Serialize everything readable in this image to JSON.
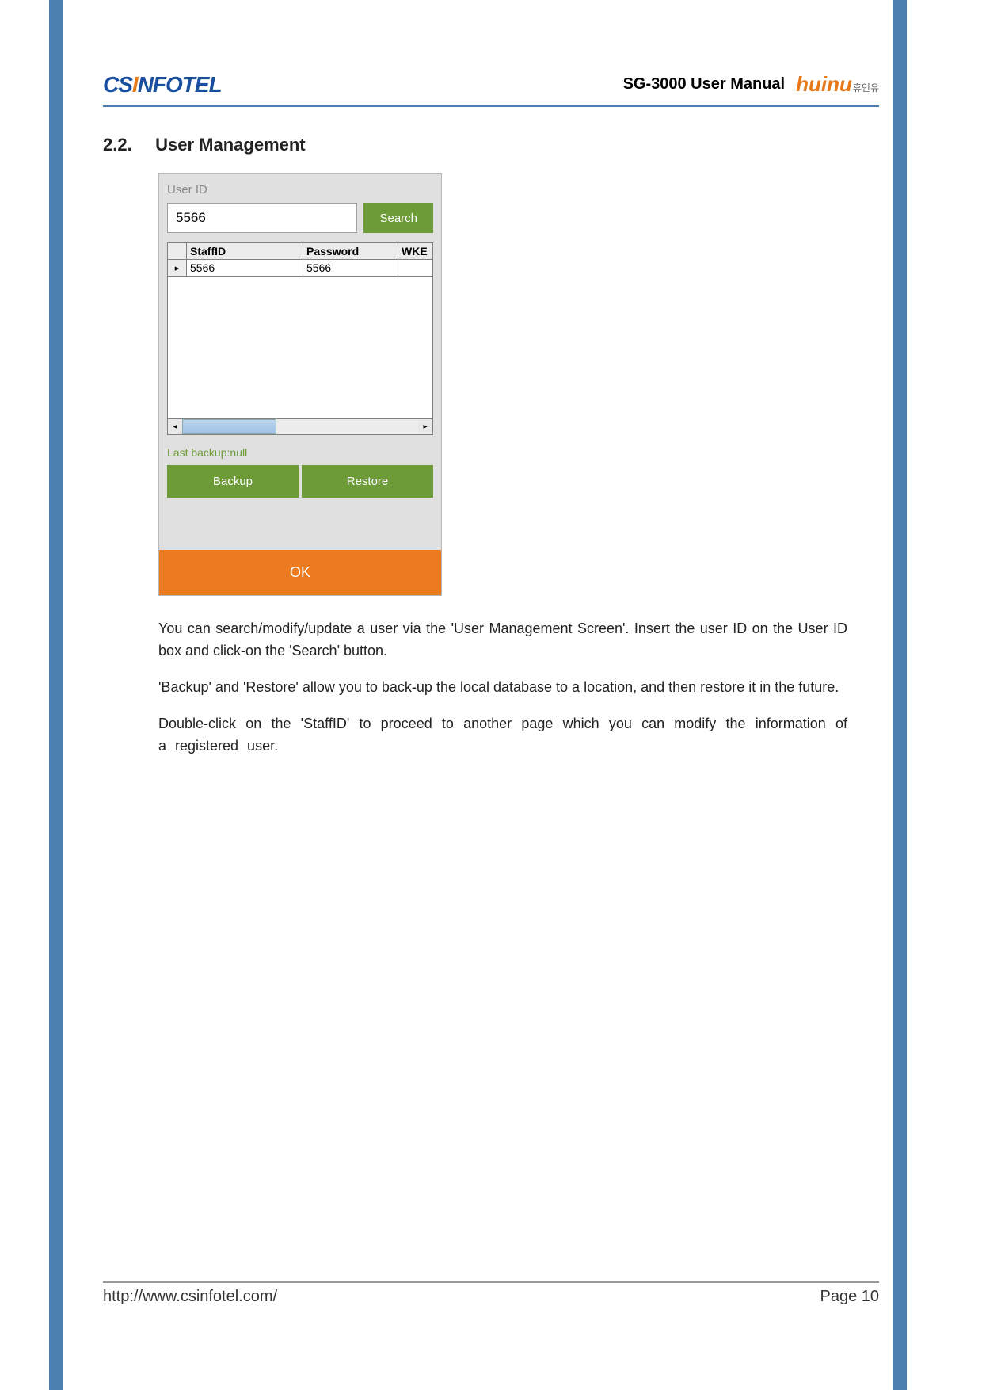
{
  "header": {
    "logo_left": {
      "part1": "CS",
      "part2": "I",
      "part3": "NFOTEL"
    },
    "doc_title": "SG-3000 User Manual",
    "logo_right": {
      "text": "huinu",
      "sub": "휴인유"
    }
  },
  "section": {
    "number": "2.2.",
    "title": "User Management"
  },
  "app": {
    "user_id_label": "User ID",
    "user_id_value": "5566",
    "search_button": "Search",
    "table": {
      "col_rowhead": "",
      "col1": "StaffID",
      "col2": "Password",
      "col3": "WKE",
      "rows": [
        {
          "marker": "▸",
          "staffid": "5566",
          "password": "5566",
          "wke": ""
        }
      ]
    },
    "last_backup_label": "Last backup:",
    "last_backup_value": "null",
    "backup_button": "Backup",
    "restore_button": "Restore",
    "ok_button": "OK"
  },
  "body": {
    "p1": "You can search/modify/update a user via the 'User Management Screen'. Insert the user ID on the User ID box and click-on the 'Search' button.",
    "p2": "'Backup' and 'Restore' allow you to back-up the local database to a location, and then restore it in the future.",
    "p3": "Double-click on the 'StaffID' to proceed to another page which you can modify the information of a registered user."
  },
  "footer": {
    "url": "http://www.csinfotel.com/",
    "page": "Page 10"
  }
}
